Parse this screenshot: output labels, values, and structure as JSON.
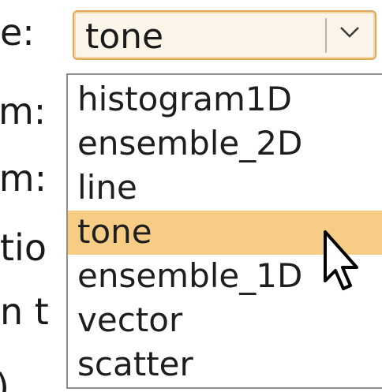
{
  "background_labels": [
    {
      "text": "e:"
    },
    {
      "text": "m:"
    },
    {
      "text": "im:"
    },
    {
      "text": "tio"
    },
    {
      "text": "n t"
    },
    {
      "text": ")"
    }
  ],
  "combobox": {
    "value": "tone"
  },
  "dropdown": {
    "options": [
      {
        "label": "histogram1D",
        "selected": false
      },
      {
        "label": "ensemble_2D",
        "selected": false
      },
      {
        "label": "line",
        "selected": false
      },
      {
        "label": "tone",
        "selected": true
      },
      {
        "label": "ensemble_1D",
        "selected": false
      },
      {
        "label": "vector",
        "selected": false
      },
      {
        "label": "scatter",
        "selected": false
      }
    ]
  },
  "colors": {
    "selection": "#f7cd86",
    "combo_border": "#e0a85a",
    "combo_fill": "#fbf4e8"
  },
  "icons": {
    "dropdown_arrow": "chevron-down-icon",
    "pointer": "mouse-cursor-icon"
  }
}
